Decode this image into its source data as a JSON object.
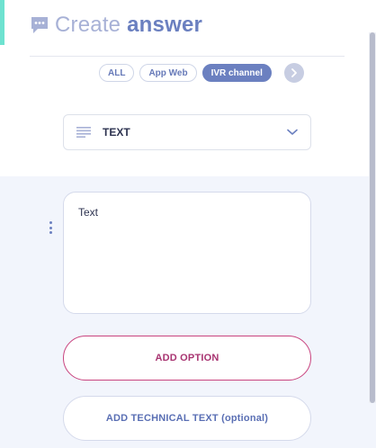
{
  "header": {
    "title_light": "Create",
    "title_bold": "answer",
    "icon": "chat-bubble-icon"
  },
  "tabs": [
    {
      "label": "ALL",
      "active": false
    },
    {
      "label": "App Web",
      "active": false
    },
    {
      "label": "IVR channel",
      "active": true
    }
  ],
  "tabs_next_icon": "chevron-right-icon",
  "type_select": {
    "value": "TEXT",
    "icon": "text-lines-icon",
    "dropdown_icon": "chevron-down-icon"
  },
  "answer": {
    "text": "Text",
    "drag_icon": "vertical-dots-icon"
  },
  "buttons": {
    "add_option": "ADD OPTION",
    "add_technical_text": "ADD TECHNICAL TEXT (optional)"
  },
  "colors": {
    "accent_teal": "#6ee2d0",
    "primary_blue": "#6b80c0",
    "option_magenta": "#a83471",
    "lower_panel_bg": "#f2f5fc"
  }
}
